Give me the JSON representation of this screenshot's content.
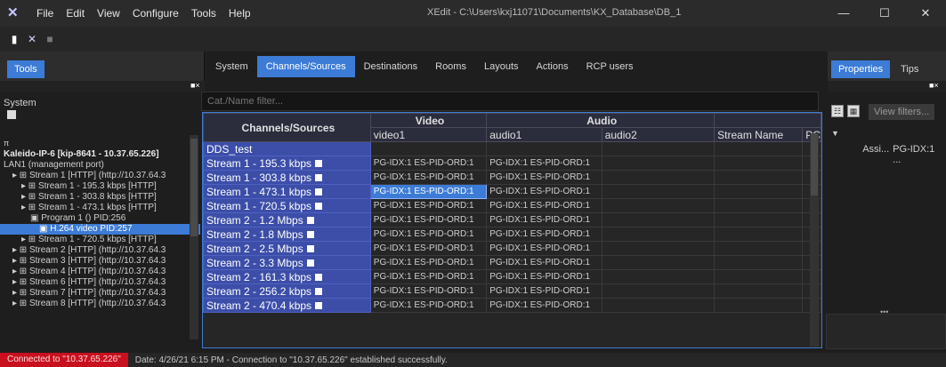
{
  "app": {
    "title": "XEdit - C:\\Users\\kxj11071\\Documents\\KX_Database\\DB_1"
  },
  "menu": [
    "File",
    "Edit",
    "View",
    "Configure",
    "Tools",
    "Help"
  ],
  "left": {
    "tab": "Tools",
    "system_label": "System",
    "selected": "H.264 video PID:257"
  },
  "tree": [
    {
      "indent": 0,
      "text": "Kaleido-IP-6 [kip-8641 - 10.37.65.226]",
      "bold": true
    },
    {
      "indent": 0,
      "text": "LAN1 (management port)"
    },
    {
      "indent": 1,
      "text": "Stream 1 [HTTP] (http://10.37.64.3"
    },
    {
      "indent": 2,
      "text": "Stream 1 - 195.3 kbps [HTTP]"
    },
    {
      "indent": 2,
      "text": "Stream 1 - 303.8 kbps [HTTP]"
    },
    {
      "indent": 2,
      "text": "Stream 1 - 473.1 kbps [HTTP]"
    },
    {
      "indent": 3,
      "text": "Program 1 () PID:256"
    },
    {
      "indent": 4,
      "text": "H.264 video PID:257"
    },
    {
      "indent": 2,
      "text": "Stream 1 - 720.5 kbps [HTTP]"
    },
    {
      "indent": 1,
      "text": "Stream 2 [HTTP] (http://10.37.64.3"
    },
    {
      "indent": 1,
      "text": "Stream 3 [HTTP] (http://10.37.64.3"
    },
    {
      "indent": 1,
      "text": "Stream 4 [HTTP] (http://10.37.64.3"
    },
    {
      "indent": 1,
      "text": "Stream 6 [HTTP] (http://10.37.64.3"
    },
    {
      "indent": 1,
      "text": "Stream 7 [HTTP] (http://10.37.64.3"
    },
    {
      "indent": 1,
      "text": "Stream 8 [HTTP] (http://10.37.64.3"
    }
  ],
  "tabs": [
    "System",
    "Channels/Sources",
    "Destinations",
    "Rooms",
    "Layouts",
    "Actions",
    "RCP users"
  ],
  "active_tab": "Channels/Sources",
  "filter": {
    "placeholder": "Cat./Name filter..."
  },
  "grid": {
    "corner": "Channels/Sources",
    "group_video": "Video",
    "group_audio": "Audio",
    "cols": [
      "video1",
      "audio1",
      "audio2",
      "Stream Name",
      "PC"
    ],
    "group_row": "DDS_test",
    "rows": [
      {
        "name": "Stream 1 - 195.3 kbps",
        "video1": "PG-IDX:1 ES-PID-ORD:1",
        "audio1": "PG-IDX:1 ES-PID-ORD:1"
      },
      {
        "name": "Stream 1 - 303.8 kbps",
        "video1": "PG-IDX:1 ES-PID-ORD:1",
        "audio1": "PG-IDX:1 ES-PID-ORD:1"
      },
      {
        "name": "Stream 1 - 473.1 kbps",
        "video1": "PG-IDX:1 ES-PID-ORD:1",
        "audio1": "PG-IDX:1 ES-PID-ORD:1",
        "selected": true
      },
      {
        "name": "Stream 1 - 720.5 kbps",
        "video1": "PG-IDX:1 ES-PID-ORD:1",
        "audio1": "PG-IDX:1 ES-PID-ORD:1"
      },
      {
        "name": "Stream 2 - 1.2 Mbps",
        "video1": "PG-IDX:1 ES-PID-ORD:1",
        "audio1": "PG-IDX:1 ES-PID-ORD:1"
      },
      {
        "name": "Stream 2 - 1.8 Mbps",
        "video1": "PG-IDX:1 ES-PID-ORD:1",
        "audio1": "PG-IDX:1 ES-PID-ORD:1"
      },
      {
        "name": "Stream 2 - 2.5 Mbps",
        "video1": "PG-IDX:1 ES-PID-ORD:1",
        "audio1": "PG-IDX:1 ES-PID-ORD:1"
      },
      {
        "name": "Stream 2 - 3.3 Mbps",
        "video1": "PG-IDX:1 ES-PID-ORD:1",
        "audio1": "PG-IDX:1 ES-PID-ORD:1"
      },
      {
        "name": "Stream 2 - 161.3 kbps",
        "video1": "PG-IDX:1 ES-PID-ORD:1",
        "audio1": "PG-IDX:1 ES-PID-ORD:1"
      },
      {
        "name": "Stream 2 - 256.2 kbps",
        "video1": "PG-IDX:1 ES-PID-ORD:1",
        "audio1": "PG-IDX:1 ES-PID-ORD:1"
      },
      {
        "name": "Stream 2 - 470.4 kbps",
        "video1": "PG-IDX:1 ES-PID-ORD:1",
        "audio1": "PG-IDX:1 ES-PID-ORD:1"
      }
    ]
  },
  "right": {
    "tab_properties": "Properties",
    "tab_tips": "Tips",
    "view_filters": "View filters...",
    "prop_name": "Assi...",
    "prop_value": "PG-IDX:1 ..."
  },
  "status": {
    "connection": "Connected to \"10.37.65.226\"",
    "message": "Date: 4/26/21 6:15 PM - Connection to \"10.37.65.226\" established successfully."
  },
  "colors": {
    "accent": "#3c7bd6",
    "error": "#c8101f",
    "header": "#3c4ea8"
  }
}
